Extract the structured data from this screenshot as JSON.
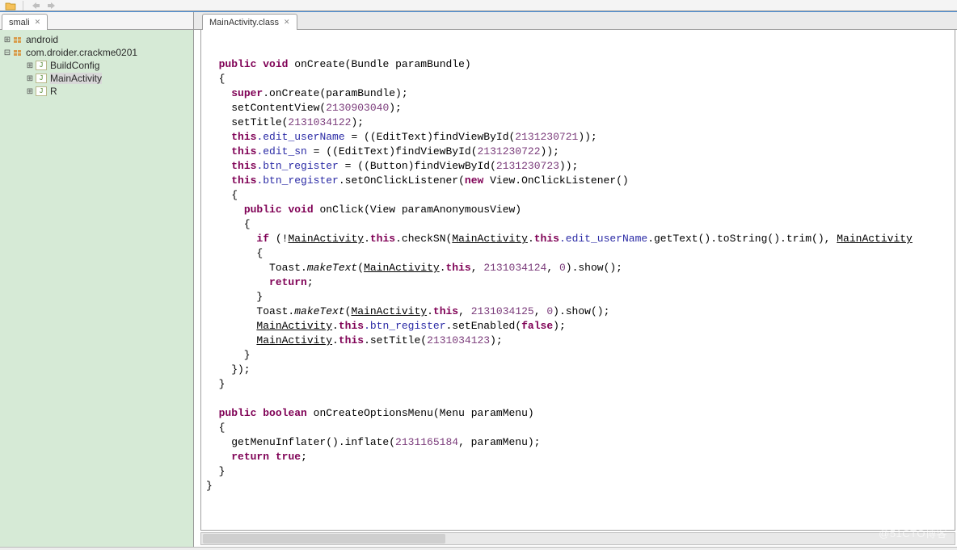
{
  "toolbar": {
    "icons": [
      "folder-open-icon",
      "divider",
      "back-icon",
      "forward-icon"
    ]
  },
  "leftTab": {
    "label": "smali"
  },
  "tree": {
    "items": [
      {
        "label": "android",
        "level": 0,
        "twisty": "+",
        "icon": "package",
        "selected": false
      },
      {
        "label": "com.droider.crackme0201",
        "level": 0,
        "twisty": "−",
        "icon": "package",
        "selected": false
      },
      {
        "label": "BuildConfig",
        "level": 2,
        "twisty": "+",
        "icon": "java",
        "selected": false
      },
      {
        "label": "MainActivity",
        "level": 2,
        "twisty": "+",
        "icon": "java",
        "selected": true
      },
      {
        "label": "R",
        "level": 2,
        "twisty": "+",
        "icon": "java",
        "selected": false
      }
    ]
  },
  "editorTab": {
    "label": "MainActivity.class"
  },
  "code": {
    "l1": {
      "k1": "public",
      "k2": "void",
      "m": "onCreate(Bundle paramBundle)"
    },
    "l2": "  {",
    "l3": {
      "k": "super",
      "rest": ".onCreate(paramBundle);"
    },
    "l4": {
      "a": "    setContentView(",
      "n": "2130903040",
      "b": ");"
    },
    "l5": {
      "a": "    setTitle(",
      "n": "2131034122",
      "b": ");"
    },
    "l6": {
      "k": "this",
      "f": ".edit_userName",
      "a": " = ((EditText)findViewById(",
      "n": "2131230721",
      "b": "));"
    },
    "l7": {
      "k": "this",
      "f": ".edit_sn",
      "a": " = ((EditText)findViewById(",
      "n": "2131230722",
      "b": "));"
    },
    "l8": {
      "k": "this",
      "f": ".btn_register",
      "a": " = ((Button)findViewById(",
      "n": "2131230723",
      "b": "));"
    },
    "l9": {
      "k": "this",
      "f": ".btn_register",
      "a": ".setOnClickListener(",
      "k2": "new",
      "c": " View.OnClickListener()"
    },
    "l10": "    {",
    "l11": {
      "k1": "public",
      "k2": "void",
      "m": "onClick(View paramAnonymousView)"
    },
    "l12": "      {",
    "l13": {
      "k": "if",
      "a": " (!",
      "u1": "MainActivity",
      "b": ".",
      "k2": "this",
      "c": ".checkSN(",
      "u2": "MainActivity",
      "d": ".",
      "k3": "this",
      "f1": ".edit_userName",
      "e": ".getText().toString().trim(), ",
      "u3": "MainActivity"
    },
    "l14": "        {",
    "l15": {
      "a": "          Toast.",
      "i": "makeText",
      "b": "(",
      "u": "MainActivity",
      "c": ".",
      "k": "this",
      "d": ", ",
      "n1": "2131034124",
      "e": ", ",
      "n2": "0",
      "f": ").show();"
    },
    "l16": {
      "k": "return",
      "a": ";"
    },
    "l17": "        }",
    "l18": {
      "a": "        Toast.",
      "i": "makeText",
      "b": "(",
      "u": "MainActivity",
      "c": ".",
      "k": "this",
      "d": ", ",
      "n1": "2131034125",
      "e": ", ",
      "n2": "0",
      "f": ").show();"
    },
    "l19": {
      "u": "MainActivity",
      "a": ".",
      "k": "this",
      "f": ".btn_register",
      "b": ".setEnabled(",
      "k2": "false",
      "c": ");"
    },
    "l20": {
      "u": "MainActivity",
      "a": ".",
      "k": "this",
      "b": ".setTitle(",
      "n": "2131034123",
      "c": ");"
    },
    "l21": "      }",
    "l22": "    });",
    "l23": "  }",
    "l24": "",
    "l25": {
      "k1": "public",
      "k2": "boolean",
      "m": "onCreateOptionsMenu(Menu paramMenu)"
    },
    "l26": "  {",
    "l27": {
      "a": "    getMenuInflater().inflate(",
      "n": "2131165184",
      "b": ", paramMenu);"
    },
    "l28": {
      "k": "return",
      "a": " ",
      "k2": "true",
      "b": ";"
    },
    "l29": "  }",
    "l30": "}"
  },
  "watermark": "@51CTO博客"
}
